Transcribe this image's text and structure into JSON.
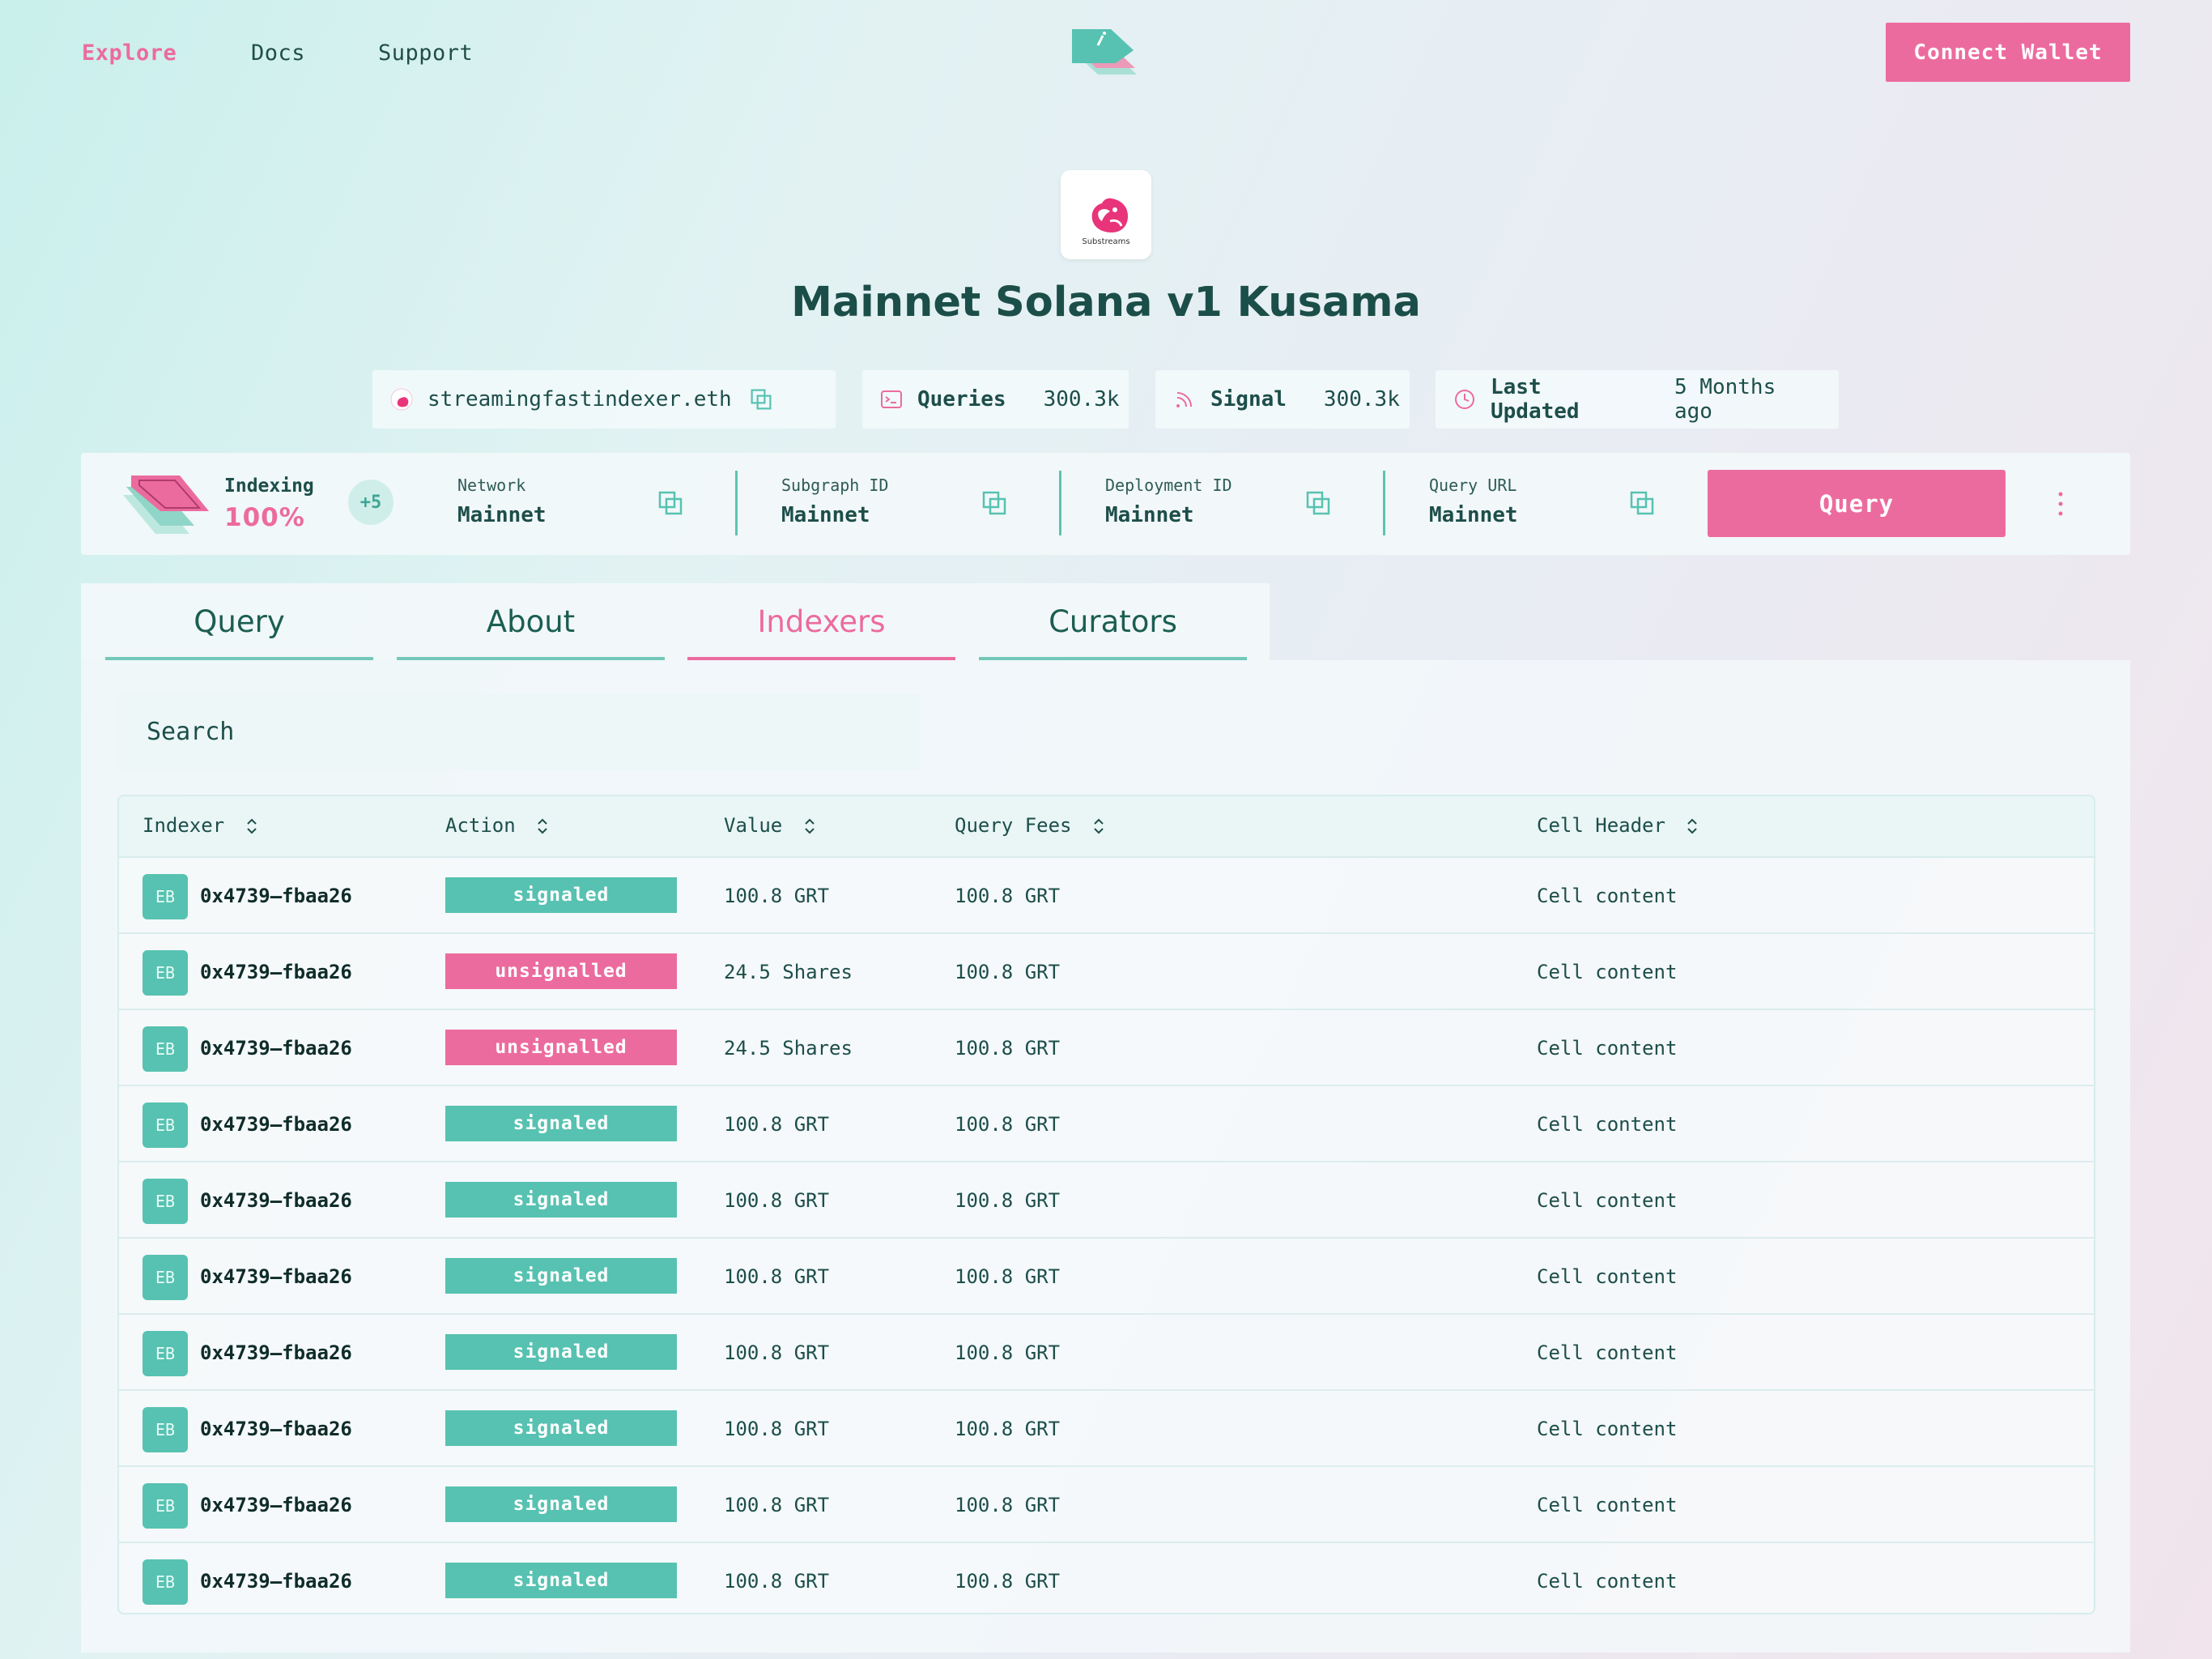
{
  "nav": {
    "links": [
      "Explore",
      "Docs",
      "Support"
    ],
    "connect_label": "Connect Wallet"
  },
  "hero": {
    "avatar_caption": "Substreams",
    "title": "Mainnet Solana v1 Kusama"
  },
  "stats": {
    "owner": "streamingfastindexer.eth",
    "queries_label": "Queries",
    "queries_value": "300.3k",
    "signal_label": "Signal",
    "signal_value": "300.3k",
    "updated_label": "Last Updated",
    "updated_value": "5 Months ago"
  },
  "info_bar": {
    "indexing_label": "Indexing",
    "indexing_pct": "100%",
    "plus_count": "+5",
    "fields": [
      {
        "label": "Network",
        "value": "Mainnet"
      },
      {
        "label": "Subgraph ID",
        "value": "Mainnet"
      },
      {
        "label": "Deployment ID",
        "value": "Mainnet"
      },
      {
        "label": "Query URL",
        "value": "Mainnet"
      }
    ],
    "query_label": "Query"
  },
  "tabs": [
    {
      "label": "Query"
    },
    {
      "label": "About"
    },
    {
      "label": "Indexers"
    },
    {
      "label": "Curators"
    }
  ],
  "active_tab": "Indexers",
  "search": {
    "placeholder": "Search"
  },
  "table": {
    "headers": [
      "Indexer",
      "Action",
      "Value",
      "Query Fees",
      "Cell Header"
    ],
    "rows": [
      {
        "badge": "EB",
        "indexer": "0x4739—fbaa26",
        "action": "signaled",
        "value": "100.8 GRT",
        "fees": "100.8 GRT",
        "cell": "Cell content"
      },
      {
        "badge": "EB",
        "indexer": "0x4739—fbaa26",
        "action": "unsignalled",
        "value": "24.5 Shares",
        "fees": "100.8 GRT",
        "cell": "Cell content"
      },
      {
        "badge": "EB",
        "indexer": "0x4739—fbaa26",
        "action": "unsignalled",
        "value": "24.5 Shares",
        "fees": "100.8 GRT",
        "cell": "Cell content"
      },
      {
        "badge": "EB",
        "indexer": "0x4739—fbaa26",
        "action": "signaled",
        "value": "100.8 GRT",
        "fees": "100.8 GRT",
        "cell": "Cell content"
      },
      {
        "badge": "EB",
        "indexer": "0x4739—fbaa26",
        "action": "signaled",
        "value": "100.8 GRT",
        "fees": "100.8 GRT",
        "cell": "Cell content"
      },
      {
        "badge": "EB",
        "indexer": "0x4739—fbaa26",
        "action": "signaled",
        "value": "100.8 GRT",
        "fees": "100.8 GRT",
        "cell": "Cell content"
      },
      {
        "badge": "EB",
        "indexer": "0x4739—fbaa26",
        "action": "signaled",
        "value": "100.8 GRT",
        "fees": "100.8 GRT",
        "cell": "Cell content"
      },
      {
        "badge": "EB",
        "indexer": "0x4739—fbaa26",
        "action": "signaled",
        "value": "100.8 GRT",
        "fees": "100.8 GRT",
        "cell": "Cell content"
      },
      {
        "badge": "EB",
        "indexer": "0x4739—fbaa26",
        "action": "signaled",
        "value": "100.8 GRT",
        "fees": "100.8 GRT",
        "cell": "Cell content"
      },
      {
        "badge": "EB",
        "indexer": "0x4739—fbaa26",
        "action": "signaled",
        "value": "100.8 GRT",
        "fees": "100.8 GRT",
        "cell": "Cell content"
      }
    ]
  },
  "colors": {
    "accent_pink": "#ec6b9e",
    "accent_teal": "#57c2b1",
    "text_dark": "#1d4e4a"
  },
  "icons": {
    "logo": "stacked-layers-logo",
    "owner": "unicorn-avatar-icon",
    "copy": "copy-icon",
    "queries": "terminal-icon",
    "signal": "signal-icon",
    "updated": "clock-icon",
    "more": "vertical-dots-icon",
    "sort": "sort-icon"
  }
}
